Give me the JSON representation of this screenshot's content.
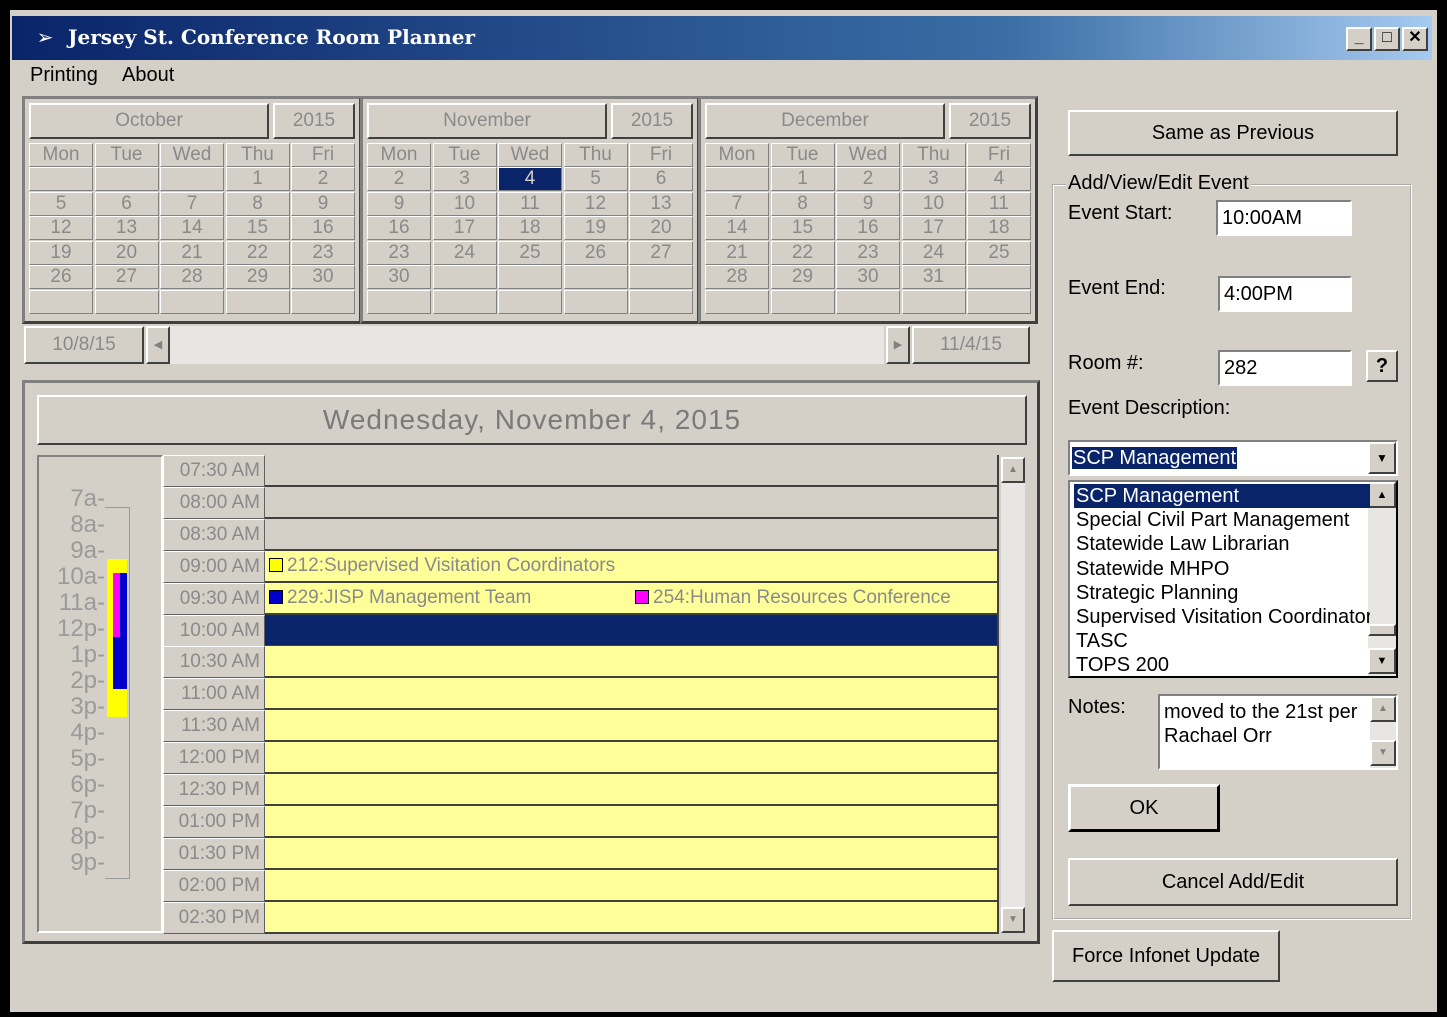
{
  "window": {
    "title": "Jersey St. Conference Room Planner",
    "controls": {
      "minimize": "_",
      "maximize": "□",
      "close": "✕"
    }
  },
  "menu": [
    "Printing",
    "About"
  ],
  "calendars": [
    {
      "month": "October",
      "year": "2015",
      "weekdays": [
        "Mon",
        "Tue",
        "Wed",
        "Thu",
        "Fri"
      ],
      "weeks": [
        [
          "",
          "",
          "",
          "1",
          "2"
        ],
        [
          "5",
          "6",
          "7",
          "8",
          "9"
        ],
        [
          "12",
          "13",
          "14",
          "15",
          "16"
        ],
        [
          "19",
          "20",
          "21",
          "22",
          "23"
        ],
        [
          "26",
          "27",
          "28",
          "29",
          "30"
        ],
        [
          "",
          "",
          "",
          "",
          ""
        ]
      ]
    },
    {
      "month": "November",
      "year": "2015",
      "weekdays": [
        "Mon",
        "Tue",
        "Wed",
        "Thu",
        "Fri"
      ],
      "weeks": [
        [
          "2",
          "3",
          "4",
          "5",
          "6"
        ],
        [
          "9",
          "10",
          "11",
          "12",
          "13"
        ],
        [
          "16",
          "17",
          "18",
          "19",
          "20"
        ],
        [
          "23",
          "24",
          "25",
          "26",
          "27"
        ],
        [
          "30",
          "",
          "",
          "",
          ""
        ],
        [
          "",
          "",
          "",
          "",
          ""
        ]
      ],
      "selected": "4"
    },
    {
      "month": "December",
      "year": "2015",
      "weekdays": [
        "Mon",
        "Tue",
        "Wed",
        "Thu",
        "Fri"
      ],
      "weeks": [
        [
          "",
          "1",
          "2",
          "3",
          "4"
        ],
        [
          "7",
          "8",
          "9",
          "10",
          "11"
        ],
        [
          "14",
          "15",
          "16",
          "17",
          "18"
        ],
        [
          "21",
          "22",
          "23",
          "24",
          "25"
        ],
        [
          "28",
          "29",
          "30",
          "31",
          ""
        ],
        [
          "",
          "",
          "",
          "",
          ""
        ]
      ]
    }
  ],
  "nav": {
    "prev_date": "10/8/15",
    "next_date": "11/4/15"
  },
  "day": {
    "title": "Wednesday, November 4, 2015",
    "overview_hours": [
      "7a-",
      "8a-",
      "9a-",
      "10a-",
      "11a-",
      "12p-",
      "1p-",
      "2p-",
      "3p-",
      "4p-",
      "5p-",
      "6p-",
      "7p-",
      "8p-",
      "9p-"
    ],
    "time_slots": [
      "07:30 AM",
      "08:00 AM",
      "08:30 AM",
      "09:00 AM",
      "09:30 AM",
      "10:00 AM",
      "10:30 AM",
      "11:00 AM",
      "11:30 AM",
      "12:00 PM",
      "12:30 PM",
      "01:00 PM",
      "01:30 PM",
      "02:00 PM",
      "02:30 PM"
    ],
    "slot_fill": [
      "empty",
      "empty",
      "empty",
      "booked",
      "booked",
      "selected",
      "booked",
      "booked",
      "booked",
      "booked",
      "booked",
      "booked",
      "booked",
      "booked",
      "booked"
    ],
    "events": [
      {
        "label": "212:Supervised Visitation Coordinators",
        "slot": "09:00 AM",
        "color": "#ffff00"
      },
      {
        "label": "229:JISP Management Team",
        "slot": "09:30 AM",
        "color": "#0000cc"
      },
      {
        "label": "254:Human Resources Conference",
        "slot": "09:30 AM",
        "color": "#ff00ff"
      }
    ],
    "colors": {
      "booked": "#ffff99",
      "selected": "#0a246a",
      "empty": "#d4d0c8"
    }
  },
  "form": {
    "same_as_previous": "Same as Previous",
    "group_label": "Add/View/Edit Event",
    "event_start_label": "Event Start:",
    "event_start": "10:00AM",
    "event_end_label": "Event End:",
    "event_end": "4:00PM",
    "room_label": "Room #:",
    "room": "282",
    "room_help": "?",
    "description_label": "Event Description:",
    "description": "SCP Management",
    "description_options": [
      "SCP Management",
      "Special Civil Part Management",
      "Statewide Law Librarian",
      "Statewide MHPO",
      "Strategic Planning",
      "Supervised Visitation Coordinator:",
      "TASC",
      "TOPS 200"
    ],
    "notes_label": "Notes:",
    "notes_lines": [
      "moved to the 21st per",
      "Rachael Orr"
    ],
    "ok": "OK",
    "cancel": "Cancel Add/Edit",
    "force_update": "Force Infonet Update"
  }
}
